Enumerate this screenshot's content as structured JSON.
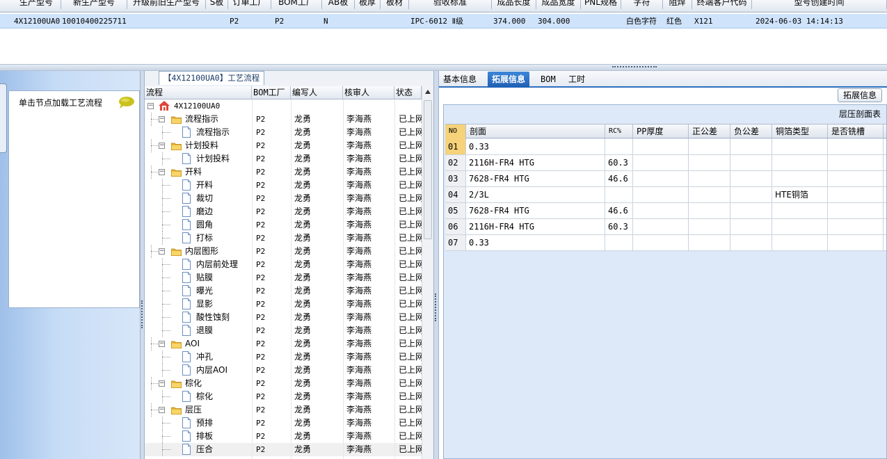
{
  "top_grid": {
    "columns": [
      "生产型号",
      "新生产型号",
      "升级前旧生产型号",
      "S板",
      "订单工厂",
      "BOM工厂",
      "AB板",
      "板厚",
      "板材",
      "验收标准",
      "成品长度",
      "成品宽度",
      "PNL规格",
      "字符",
      "阻焊",
      "终端客户代码",
      "型号创建时间"
    ],
    "row": [
      "4X12100UA0",
      "10010400225711",
      "",
      "",
      "P2",
      "P2",
      "N",
      "",
      "",
      "IPC-6012 Ⅱ级",
      "374.000",
      "304.000",
      "",
      "白色字符",
      "红色",
      "X121",
      "2024-06-03 14:14:13"
    ]
  },
  "left_nav": {
    "load_label": "单击节点加载工艺流程"
  },
  "tree": {
    "title": "【4X12100UA0】工艺流程",
    "columns": [
      "流程",
      "BOM工厂",
      "编写人",
      "核审人",
      "状态"
    ],
    "rows": [
      {
        "level": 0,
        "kind": "root",
        "label": "4X12100UA0",
        "bom": "",
        "writer": "",
        "reviewer": "",
        "status": ""
      },
      {
        "level": 1,
        "kind": "folder",
        "label": "流程指示",
        "bom": "P2",
        "writer": "龙勇",
        "reviewer": "李海燕",
        "status": "已上网"
      },
      {
        "level": 2,
        "kind": "doc",
        "label": "流程指示",
        "bom": "P2",
        "writer": "龙勇",
        "reviewer": "李海燕",
        "status": "已上网"
      },
      {
        "level": 1,
        "kind": "folder",
        "label": "计划投料",
        "bom": "P2",
        "writer": "龙勇",
        "reviewer": "李海燕",
        "status": "已上网"
      },
      {
        "level": 2,
        "kind": "doc",
        "label": "计划投料",
        "bom": "P2",
        "writer": "龙勇",
        "reviewer": "李海燕",
        "status": "已上网"
      },
      {
        "level": 1,
        "kind": "folder",
        "label": "开料",
        "bom": "P2",
        "writer": "龙勇",
        "reviewer": "李海燕",
        "status": "已上网"
      },
      {
        "level": 2,
        "kind": "doc",
        "label": "开料",
        "bom": "P2",
        "writer": "龙勇",
        "reviewer": "李海燕",
        "status": "已上网"
      },
      {
        "level": 2,
        "kind": "doc",
        "label": "裁切",
        "bom": "P2",
        "writer": "龙勇",
        "reviewer": "李海燕",
        "status": "已上网"
      },
      {
        "level": 2,
        "kind": "doc",
        "label": "磨边",
        "bom": "P2",
        "writer": "龙勇",
        "reviewer": "李海燕",
        "status": "已上网"
      },
      {
        "level": 2,
        "kind": "doc",
        "label": "圆角",
        "bom": "P2",
        "writer": "龙勇",
        "reviewer": "李海燕",
        "status": "已上网"
      },
      {
        "level": 2,
        "kind": "doc",
        "label": "打标",
        "bom": "P2",
        "writer": "龙勇",
        "reviewer": "李海燕",
        "status": "已上网"
      },
      {
        "level": 1,
        "kind": "folder",
        "label": "内层图形",
        "bom": "P2",
        "writer": "龙勇",
        "reviewer": "李海燕",
        "status": "已上网"
      },
      {
        "level": 2,
        "kind": "doc",
        "label": "内层前处理",
        "bom": "P2",
        "writer": "龙勇",
        "reviewer": "李海燕",
        "status": "已上网"
      },
      {
        "level": 2,
        "kind": "doc",
        "label": "贴膜",
        "bom": "P2",
        "writer": "龙勇",
        "reviewer": "李海燕",
        "status": "已上网"
      },
      {
        "level": 2,
        "kind": "doc",
        "label": "曝光",
        "bom": "P2",
        "writer": "龙勇",
        "reviewer": "李海燕",
        "status": "已上网"
      },
      {
        "level": 2,
        "kind": "doc",
        "label": "显影",
        "bom": "P2",
        "writer": "龙勇",
        "reviewer": "李海燕",
        "status": "已上网"
      },
      {
        "level": 2,
        "kind": "doc",
        "label": "酸性蚀刻",
        "bom": "P2",
        "writer": "龙勇",
        "reviewer": "李海燕",
        "status": "已上网"
      },
      {
        "level": 2,
        "kind": "doc",
        "label": "退膜",
        "bom": "P2",
        "writer": "龙勇",
        "reviewer": "李海燕",
        "status": "已上网"
      },
      {
        "level": 1,
        "kind": "folder",
        "label": "AOI",
        "bom": "P2",
        "writer": "龙勇",
        "reviewer": "李海燕",
        "status": "已上网"
      },
      {
        "level": 2,
        "kind": "doc",
        "label": "冲孔",
        "bom": "P2",
        "writer": "龙勇",
        "reviewer": "李海燕",
        "status": "已上网"
      },
      {
        "level": 2,
        "kind": "doc",
        "label": "内层AOI",
        "bom": "P2",
        "writer": "龙勇",
        "reviewer": "李海燕",
        "status": "已上网"
      },
      {
        "level": 1,
        "kind": "folder",
        "label": "棕化",
        "bom": "P2",
        "writer": "龙勇",
        "reviewer": "李海燕",
        "status": "已上网"
      },
      {
        "level": 2,
        "kind": "doc",
        "label": "棕化",
        "bom": "P2",
        "writer": "龙勇",
        "reviewer": "李海燕",
        "status": "已上网"
      },
      {
        "level": 1,
        "kind": "folder",
        "label": "层压",
        "bom": "P2",
        "writer": "龙勇",
        "reviewer": "李海燕",
        "status": "已上网"
      },
      {
        "level": 2,
        "kind": "doc",
        "label": "预排",
        "bom": "P2",
        "writer": "龙勇",
        "reviewer": "李海燕",
        "status": "已上网"
      },
      {
        "level": 2,
        "kind": "doc",
        "label": "排板",
        "bom": "P2",
        "writer": "龙勇",
        "reviewer": "李海燕",
        "status": "已上网"
      },
      {
        "level": 2,
        "kind": "doc",
        "label": "压合",
        "bom": "P2",
        "writer": "龙勇",
        "reviewer": "李海燕",
        "status": "已上网",
        "selected": true
      }
    ]
  },
  "right": {
    "tabs": [
      "基本信息",
      "拓展信息",
      "BOM",
      "工时"
    ],
    "active_tab": 1,
    "ext_button": "拓展信息",
    "stack_caption": "层压剖面表",
    "stack_columns": [
      "NO",
      "剖面",
      "RC%",
      "PP厚度",
      "正公差",
      "负公差",
      "铜箔类型",
      "是否铣槽"
    ],
    "stack_rows": [
      [
        "01",
        "0.33",
        "",
        "",
        "",
        "",
        "",
        ""
      ],
      [
        "02",
        "2116H-FR4 HTG",
        "60.3",
        "",
        "",
        "",
        "",
        ""
      ],
      [
        "03",
        "7628-FR4 HTG",
        "46.6",
        "",
        "",
        "",
        "",
        ""
      ],
      [
        "04",
        "2/3L",
        "",
        "",
        "",
        "",
        "HTE铜箔",
        ""
      ],
      [
        "05",
        "7628-FR4 HTG",
        "46.6",
        "",
        "",
        "",
        "",
        ""
      ],
      [
        "06",
        "2116H-FR4 HTG",
        "60.3",
        "",
        "",
        "",
        "",
        ""
      ],
      [
        "07",
        "0.33",
        "",
        "",
        "",
        "",
        "",
        ""
      ]
    ]
  },
  "colors": {
    "selected_row": "#cfe3fb",
    "active_tab": "#1e5fb3",
    "row_marker": "#f6d27a"
  }
}
